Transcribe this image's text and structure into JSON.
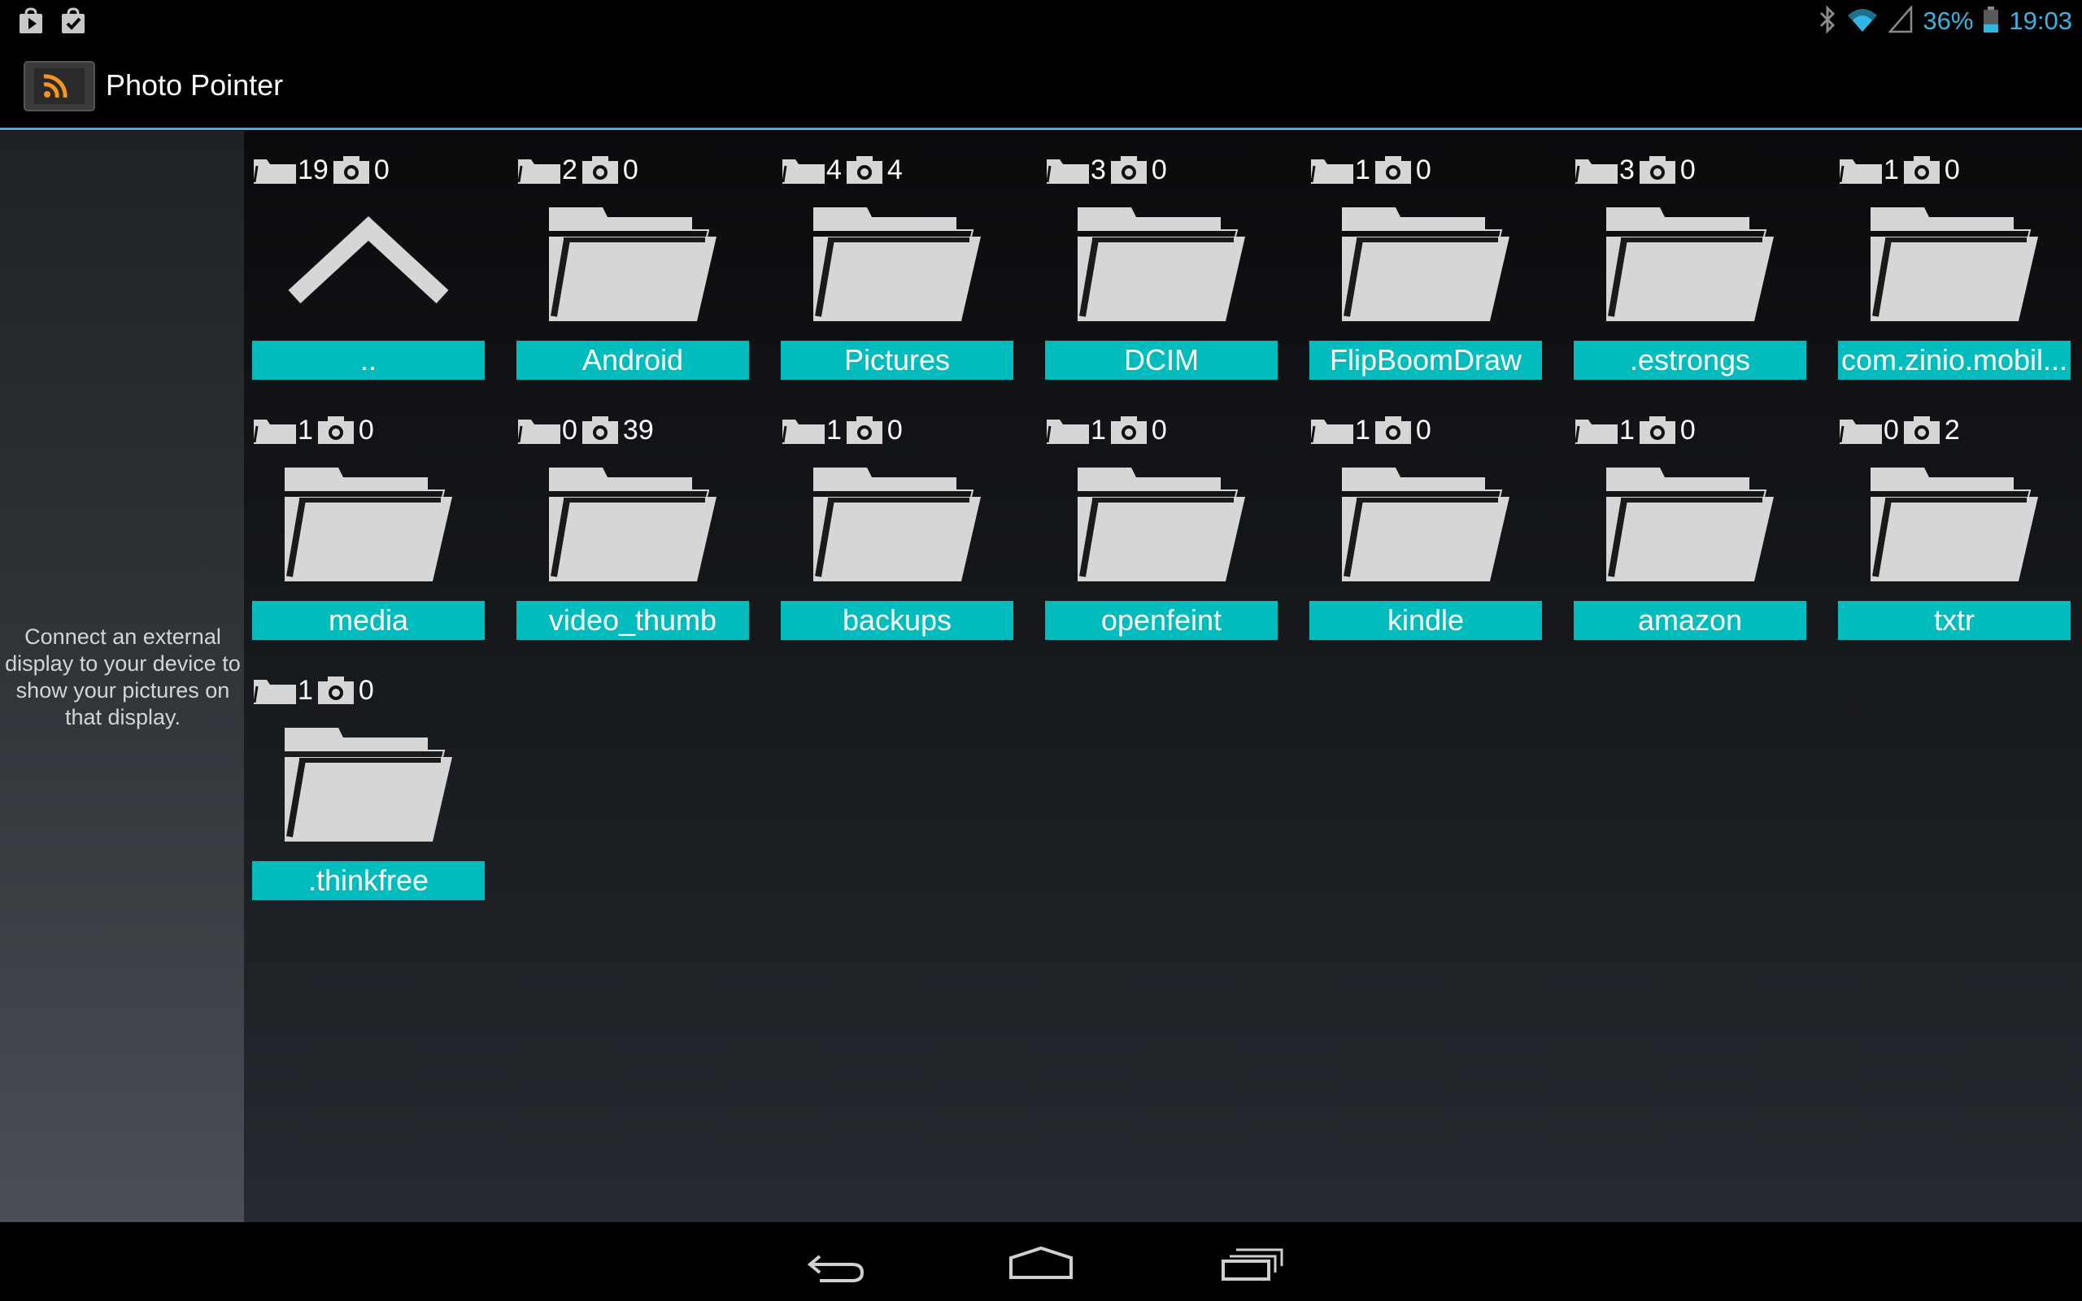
{
  "status_bar": {
    "notification_icons": [
      "play-store-icon",
      "store-check-icon"
    ],
    "system_icons": [
      "bluetooth-icon",
      "wifi-icon",
      "cell-signal-icon"
    ],
    "battery": "36%",
    "battery_level": 0.36,
    "time": "19:03"
  },
  "action_bar": {
    "title": "Photo Pointer",
    "icon": "rss-feed-icon"
  },
  "side_panel": {
    "message": "Connect an external display to your device to show your pictures on that display."
  },
  "colors": {
    "accent": "#33b5e5",
    "label_bg": "#00bcbc",
    "icon_grey": "#d6d6d6",
    "rss_orange": "#f7931e"
  },
  "folders": [
    {
      "name": "..",
      "subfolders": "19",
      "photos": "0",
      "icon": "up-chevron-icon"
    },
    {
      "name": "Android",
      "subfolders": "2",
      "photos": "0",
      "icon": "folder-icon"
    },
    {
      "name": "Pictures",
      "subfolders": "4",
      "photos": "4",
      "icon": "folder-icon"
    },
    {
      "name": "DCIM",
      "subfolders": "3",
      "photos": "0",
      "icon": "folder-icon"
    },
    {
      "name": "FlipBoomDraw",
      "subfolders": "1",
      "photos": "0",
      "icon": "folder-icon"
    },
    {
      "name": ".estrongs",
      "subfolders": "3",
      "photos": "0",
      "icon": "folder-icon"
    },
    {
      "name": "com.zinio.mobil...",
      "subfolders": "1",
      "photos": "0",
      "icon": "folder-icon"
    },
    {
      "name": "media",
      "subfolders": "1",
      "photos": "0",
      "icon": "folder-icon"
    },
    {
      "name": "video_thumb",
      "subfolders": "0",
      "photos": "39",
      "icon": "folder-icon"
    },
    {
      "name": "backups",
      "subfolders": "1",
      "photos": "0",
      "icon": "folder-icon"
    },
    {
      "name": "openfeint",
      "subfolders": "1",
      "photos": "0",
      "icon": "folder-icon"
    },
    {
      "name": "kindle",
      "subfolders": "1",
      "photos": "0",
      "icon": "folder-icon"
    },
    {
      "name": "amazon",
      "subfolders": "1",
      "photos": "0",
      "icon": "folder-icon"
    },
    {
      "name": "txtr",
      "subfolders": "0",
      "photos": "2",
      "icon": "folder-icon"
    },
    {
      "name": ".thinkfree",
      "subfolders": "1",
      "photos": "0",
      "icon": "folder-icon"
    }
  ],
  "nav_bar": {
    "buttons": [
      "back-icon",
      "home-icon",
      "recent-apps-icon"
    ]
  }
}
